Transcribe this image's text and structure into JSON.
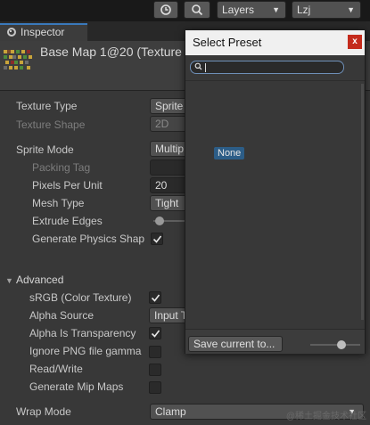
{
  "toolbar": {
    "history_icon": "history-icon",
    "search_icon": "search-icon",
    "layers_label": "Layers",
    "layout_label": "Lzj"
  },
  "tab": {
    "label": "Inspector",
    "icon": "info-icon"
  },
  "header": {
    "asset_name": "Base Map 1@20 (Texture"
  },
  "texture": {
    "texture_type_label": "Texture Type",
    "texture_type_value": "Sprite",
    "texture_shape_label": "Texture Shape",
    "texture_shape_value": "2D",
    "sprite_mode_label": "Sprite Mode",
    "sprite_mode_value": "Multip",
    "packing_tag_label": "Packing Tag",
    "packing_tag_value": "",
    "pixels_per_unit_label": "Pixels Per Unit",
    "pixels_per_unit_value": "20",
    "mesh_type_label": "Mesh Type",
    "mesh_type_value": "Tight",
    "extrude_edges_label": "Extrude Edges",
    "generate_physics_label": "Generate Physics Shap",
    "generate_physics_checked": true
  },
  "advanced": {
    "label": "Advanced",
    "srgb_label": "sRGB (Color Texture)",
    "srgb_checked": true,
    "alpha_source_label": "Alpha Source",
    "alpha_source_value": "Input T",
    "alpha_transparency_label": "Alpha Is Transparency",
    "alpha_transparency_checked": true,
    "ignore_png_label": "Ignore PNG file gamma",
    "ignore_png_checked": false,
    "read_write_label": "Read/Write",
    "read_write_checked": false,
    "generate_mip_label": "Generate Mip Maps",
    "generate_mip_checked": false
  },
  "wrap": {
    "label": "Wrap Mode",
    "value": "Clamp"
  },
  "popup": {
    "title": "Select Preset",
    "close_label": "x",
    "search_value": "",
    "none_label": "None",
    "save_label": "Save current to..."
  },
  "watermark": "@稀土掘金技术社区",
  "colors": {
    "accent": "#3a79bb",
    "selection": "#2c5d87",
    "close": "#c42b1c",
    "panel": "#383838"
  }
}
